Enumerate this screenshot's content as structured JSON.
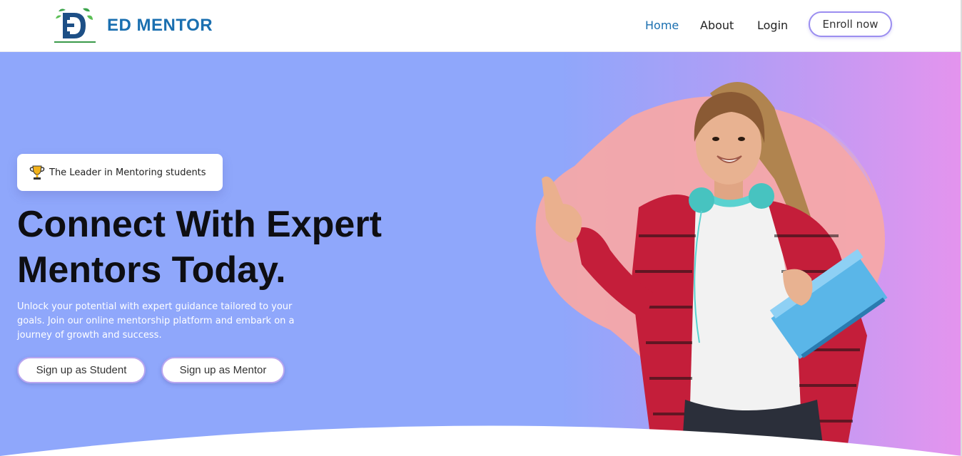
{
  "header": {
    "brand": "ED MENTOR",
    "nav": [
      {
        "label": "Home",
        "active": true
      },
      {
        "label": "About",
        "active": false
      },
      {
        "label": "Login",
        "active": false
      }
    ],
    "enroll_label": "Enroll now"
  },
  "hero": {
    "badge_text": "The Leader in Mentoring students",
    "badge_icon": "trophy-icon",
    "headline_line1": "Connect With Expert",
    "headline_line2": "Mentors Today.",
    "subtext": "Unlock your potential with expert guidance tailored to your goals. Join our online mentorship platform and embark on a journey of growth and success.",
    "student_button": "Sign up as Student",
    "mentor_button": "Sign up as Mentor"
  },
  "colors": {
    "brand": "#1a6fb0",
    "hero_start": "#8fa7fb",
    "hero_end": "#e494ee",
    "blob": "#f6a8a8"
  }
}
